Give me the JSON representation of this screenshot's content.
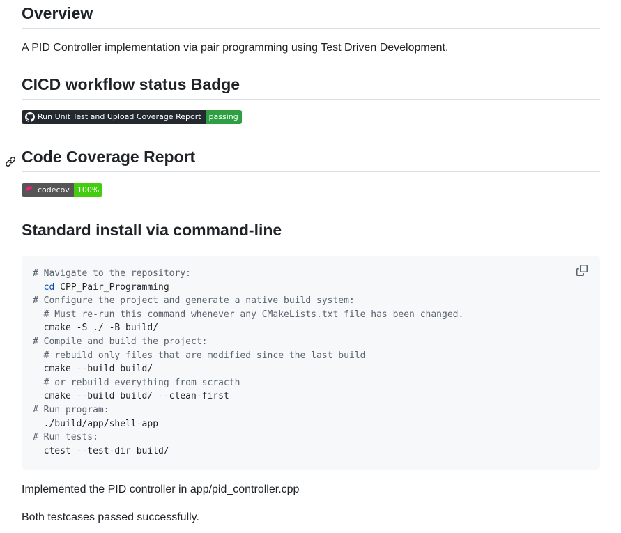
{
  "overview": {
    "heading": "Overview",
    "description": "A PID Controller implementation via pair programming using Test Driven Development."
  },
  "cicd": {
    "heading": "CICD workflow status Badge",
    "badge": {
      "icon": "github-icon",
      "label": "Run Unit Test and Upload Coverage Report",
      "status": "passing"
    }
  },
  "coverage": {
    "heading": "Code Coverage Report",
    "anchor_icon": "link-icon",
    "badge": {
      "icon": "codecov-icon",
      "label": "codecov",
      "value": "100%"
    }
  },
  "install": {
    "heading": "Standard install via command-line",
    "copy_icon": "copy-icon",
    "code_lines": [
      {
        "indent": "",
        "type": "comment",
        "text": "# Navigate to the repository:"
      },
      {
        "indent": "  ",
        "type": "cd",
        "keyword": "cd",
        "text": " CPP_Pair_Programming"
      },
      {
        "indent": "",
        "type": "comment",
        "text": "# Configure the project and generate a native build system:"
      },
      {
        "indent": "  ",
        "type": "comment",
        "text": "# Must re-run this command whenever any CMakeLists.txt file has been changed."
      },
      {
        "indent": "  ",
        "type": "cmd",
        "text": "cmake -S ./ -B build/"
      },
      {
        "indent": "",
        "type": "comment",
        "text": "# Compile and build the project:"
      },
      {
        "indent": "  ",
        "type": "comment",
        "text": "# rebuild only files that are modified since the last build"
      },
      {
        "indent": "  ",
        "type": "cmd",
        "text": "cmake --build build/"
      },
      {
        "indent": "  ",
        "type": "comment",
        "text": "# or rebuild everything from scracth"
      },
      {
        "indent": "  ",
        "type": "cmd",
        "text": "cmake --build build/ --clean-first"
      },
      {
        "indent": "",
        "type": "comment",
        "text": "# Run program:"
      },
      {
        "indent": "  ",
        "type": "cmd",
        "text": "./build/app/shell-app"
      },
      {
        "indent": "",
        "type": "comment",
        "text": "# Run tests:"
      },
      {
        "indent": "  ",
        "type": "cmd",
        "text": "ctest --test-dir build/"
      }
    ]
  },
  "footer": {
    "line1": "Implemented the PID controller in app/pid_controller.cpp",
    "line2": "Both testcases passed successfully."
  }
}
